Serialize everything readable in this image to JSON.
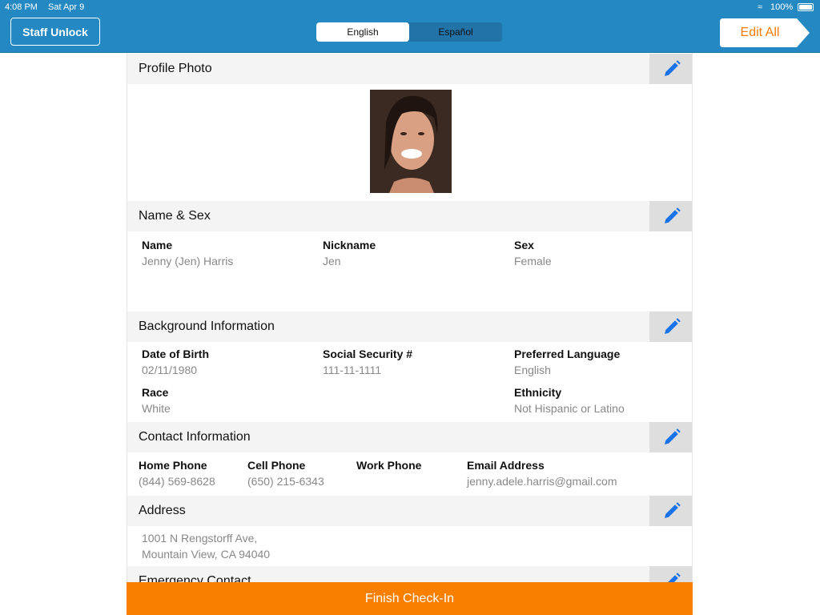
{
  "status": {
    "time": "4:08 PM",
    "date": "Sat Apr 9",
    "battery": "100%"
  },
  "toolbar": {
    "staff_unlock": "Staff Unlock",
    "languages": [
      "English",
      "Español"
    ],
    "selected_language": "English",
    "edit_all": "Edit All"
  },
  "colors": {
    "header": "#2488c2",
    "accent": "#f97f00",
    "pencil": "#1a73e8"
  },
  "sections": {
    "photo": {
      "title": "Profile Photo"
    },
    "name": {
      "title": "Name & Sex",
      "fields": [
        {
          "label": "Name",
          "value": "Jenny (Jen) Harris"
        },
        {
          "label": "Nickname",
          "value": "Jen"
        },
        {
          "label": "Sex",
          "value": "Female"
        }
      ]
    },
    "background": {
      "title": "Background Information",
      "fields": [
        {
          "label": "Date of Birth",
          "value": "02/11/1980"
        },
        {
          "label": "Social Security #",
          "value": "111-11-1111"
        },
        {
          "label": "Preferred Language",
          "value": "English"
        },
        {
          "label": "Race",
          "value": "White"
        },
        {
          "label": "Ethnicity",
          "value": "Not Hispanic or Latino"
        }
      ]
    },
    "contact": {
      "title": "Contact Information",
      "fields": [
        {
          "label": "Home Phone",
          "value": "(844) 569-8628"
        },
        {
          "label": "Cell Phone",
          "value": "(650) 215-6343"
        },
        {
          "label": "Work Phone",
          "value": ""
        },
        {
          "label": "Email Address",
          "value": "jenny.adele.harris@gmail.com"
        }
      ]
    },
    "address": {
      "title": "Address",
      "line1": "1001 N Rengstorff Ave,",
      "line2": "Mountain View, CA 94040"
    },
    "emergency": {
      "title": "Emergency Contact"
    }
  },
  "footer": {
    "finish": "Finish Check-In"
  }
}
